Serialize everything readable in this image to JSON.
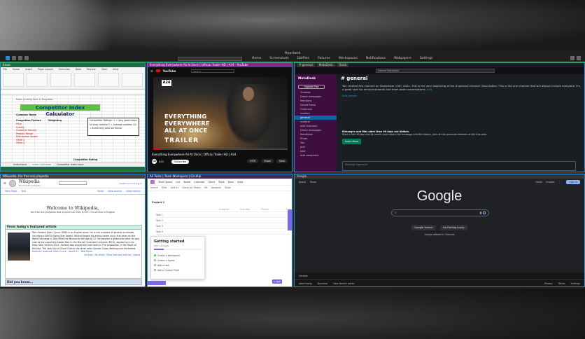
{
  "taskbar": {
    "title": "Hyprland",
    "items": [
      "Home",
      "Screenshots",
      "Dotfiles",
      "Pictures",
      "Workspaces",
      "Notifications",
      "Wallpapers",
      "Settings"
    ]
  },
  "excel": {
    "window_title": "Excel",
    "tabs": [
      "File",
      "Home",
      "Insert",
      "Page Layout",
      "Formulas",
      "Data",
      "Review",
      "View",
      "Help"
    ],
    "subtitle": "Kabel Grafting Tools & Templates",
    "heading_a": "Competitor",
    "heading_b": "Index Calculator",
    "company_name_label": "Company Name",
    "company_name_value": "My Company Inc",
    "factors_label": "Competitor Factors",
    "weighting_label": "Weighting",
    "factors": [
      "Price",
      "Quality",
      "Customer Service",
      "Product Range",
      "Distribution Speed",
      "Other 1",
      "Other 2"
    ],
    "ratings_box": "Competitor Ratings: 1 = Very good place to shop relative 5 = Average position 10 = Extremely poor performer",
    "sheet_tabs": [
      "Instructions",
      "Index Calculator",
      "Competitor Index Input"
    ],
    "competitor_rating": "Competitor Rating"
  },
  "youtube": {
    "window_title": "Everything Everywhere All At Once | Official Trailer HD | A24 - YouTube",
    "brand": "YouTube",
    "search_placeholder": "Search",
    "a24": "A24",
    "overlay_line1": "EVERYTHING",
    "overlay_line2": "EVERYWHERE",
    "overlay_line3": "ALL AT ONCE",
    "trailer": "TRAILER",
    "video_title": "Everything Everywhere All At Once | Official Trailer HD | A24",
    "channel": "A24",
    "subscribe": "Subscribe",
    "actions": [
      "197K",
      "Share",
      "Save"
    ]
  },
  "slack": {
    "window_title": "general - MetaDesk - Slack",
    "tabs": [
      "# general",
      "MetaDesk",
      "Slack"
    ],
    "search_placeholder": "Search MetaDesk",
    "workspace": "MetaDesk",
    "upgrade": "Upgrade Plan",
    "nav": [
      "Threads",
      "Direct messages",
      "Mentions",
      "Saved items",
      "Channels",
      "random",
      "general",
      "readme",
      "Add channels",
      "Direct messages",
      "MetaDesk",
      "Ethan",
      "You",
      "Jack",
      "Nick",
      "Add coworkers"
    ],
    "active_index": 6,
    "channel_title": "# general",
    "intro": "You created this channel on September 14th, 2022. This is the very beginning of the # general channel. Description: This is the one channel that will always include everyone. It's a great spot for announcements and team-wide conversations.",
    "edit_link": "Edit",
    "add_people": "Add people",
    "notice_title": "Messages and files older than 90 days are hidden.",
    "notice_body": "Start a free 30-day trial to unlock your team's full message and file history, plus all the premium features of the free plan.",
    "learn_more": "Learn More",
    "composer_placeholder": "Message #general"
  },
  "wikipedia": {
    "window_title": "Wikipedia, the free encyclopedia",
    "wordmark": "Wikipedia",
    "tagline": "The Free Encyclopedia",
    "header_right": "Create account  Log in",
    "tabs": [
      "Main Page",
      "Talk",
      "Read",
      "View source",
      "View history"
    ],
    "welcome": "Welcome to Wikipedia,",
    "welcome_sub": "the free encyclopedia that anyone can edit. 6,595,734 articles in English",
    "featured_title": "From today's featured article",
    "featured_text": "Tom Holland (born 1 June 1996) is an English actor. He is the recipient of several accolades including a BAFTA Rising Star Award. Holland began his acting career as a child actor on the West End stage in Billy Elliot the Musical at the age of 12. He became a global star after he was cast as the superhero Spider-Man in the Marvel Cinematic Universe (MCU), appearing in six films from 2016 to 2021. Holland also played the lead roles in The Impossible, In the Heart of the Sea, The Lost City of Z and Cherry. His other roles include Chaos Walking and Uncharted.",
    "featured_more": "Recently featured: Marie Curie · Apollo 11 · Bob Dylan",
    "archive": "Archive · By email · More featured articles · About",
    "dyk": "Did you know..."
  },
  "clickup": {
    "window_title": "All Tasks | Team Workspace | ClickUp",
    "workspace": "Team Space",
    "nav": [
      "List",
      "Board",
      "Calendar",
      "Gantt",
      "Table",
      "Docs",
      "View"
    ],
    "filters": [
      "Search",
      "Filter",
      "Sort by",
      "Group by: Status",
      "Me",
      "Assignee",
      "Show"
    ],
    "project": "Project 1",
    "columns": [
      "Assignee",
      "Due date",
      "Priority"
    ],
    "tasks": [
      "Task 1",
      "Task 2",
      "Task 3",
      "Task 4"
    ],
    "getting_started": "Getting started",
    "progress_text": "20% complete",
    "progress_value": 0.2,
    "checklist": [
      {
        "label": "Create a Workspace",
        "done": true
      },
      {
        "label": "Create a Space",
        "done": false
      },
      {
        "label": "Add a task",
        "done": false
      },
      {
        "label": "Add a Custom Field",
        "done": false
      }
    ],
    "add_label": "+ Task"
  },
  "google": {
    "window_title": "Google",
    "left_links": [
      "About",
      "Store"
    ],
    "right_links": [
      "Gmail",
      "Images"
    ],
    "sign_in": "Sign in",
    "logo": "Google",
    "buttons": [
      "Google Search",
      "I'm Feeling Lucky"
    ],
    "lang": "Google offered in: Français",
    "country": "Canada",
    "footer_left": [
      "Advertising",
      "Business",
      "How Search works"
    ],
    "footer_right": [
      "Privacy",
      "Terms",
      "Settings"
    ]
  }
}
